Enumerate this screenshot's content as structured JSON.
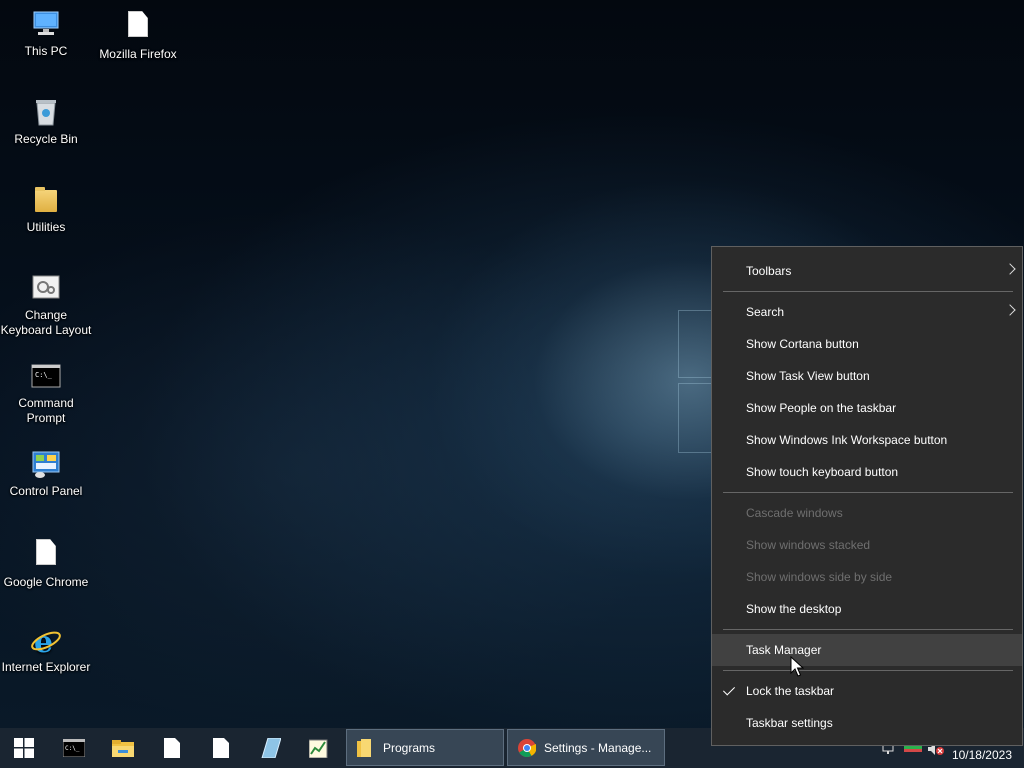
{
  "desktop": {
    "icons": [
      {
        "label": "This PC",
        "icon": "computer-icon"
      },
      {
        "label": "Mozilla Firefox",
        "icon": "document-icon"
      },
      {
        "label": "Recycle Bin",
        "icon": "recycle-bin-icon"
      },
      {
        "label": "Utilities",
        "icon": "folder-icon"
      },
      {
        "label": "Change Keyboard Layout",
        "icon": "keyboard-settings-icon"
      },
      {
        "label": "Command Prompt",
        "icon": "command-prompt-icon"
      },
      {
        "label": "Control Panel",
        "icon": "control-panel-icon"
      },
      {
        "label": "Google Chrome",
        "icon": "document-icon"
      },
      {
        "label": "Internet Explorer",
        "icon": "internet-explorer-icon"
      }
    ]
  },
  "context_menu": {
    "toolbars": "Toolbars",
    "search": "Search",
    "show_cortana": "Show Cortana button",
    "show_task_view": "Show Task View button",
    "show_people": "Show People on the taskbar",
    "show_ink": "Show Windows Ink Workspace button",
    "show_touch_keyboard": "Show touch keyboard button",
    "cascade": "Cascade windows",
    "stacked": "Show windows stacked",
    "side_by_side": "Show windows side by side",
    "show_desktop": "Show the desktop",
    "task_manager": "Task Manager",
    "lock_taskbar": "Lock the taskbar",
    "taskbar_settings": "Taskbar settings"
  },
  "taskbar": {
    "programs_label": "Programs",
    "settings_label": "Settings - Manage...",
    "clock_date": "10/18/2023"
  },
  "colors": {
    "menu_bg": "#2b2b2b",
    "menu_hover": "#414141",
    "disabled_text": "#6f6f6f",
    "taskbar_bg": "#1c2632"
  }
}
